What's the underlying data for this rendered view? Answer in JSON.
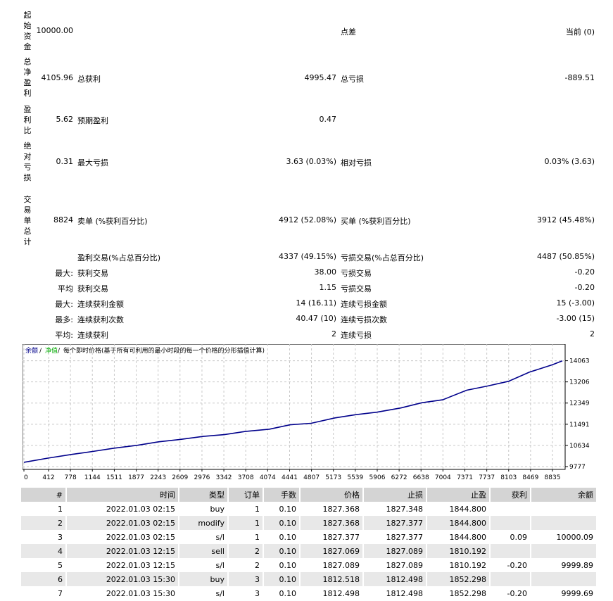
{
  "summary": {
    "initial_deposit": {
      "label": "起始资金",
      "value": "10000.00"
    },
    "spread": {
      "label": "点差",
      "value": "当前 (0)"
    },
    "net_profit": {
      "label": "总净盈利",
      "value": "4105.96"
    },
    "gross_profit": {
      "label": "总获利",
      "value": "4995.47"
    },
    "gross_loss": {
      "label": "总亏损",
      "value": "-889.51"
    },
    "profit_factor": {
      "label": "盈利比",
      "value": "5.62"
    },
    "expected_payoff": {
      "label": "预期盈利",
      "value": "0.47"
    },
    "abs_drawdown": {
      "label": "绝对亏损",
      "value": "0.31"
    },
    "max_drawdown": {
      "label": "最大亏损",
      "value": "3.63 (0.03%)"
    },
    "rel_drawdown": {
      "label": "相对亏损",
      "value": "0.03% (3.63)"
    },
    "total_trades": {
      "label": "交易单总计",
      "value": "8824"
    },
    "short_positions": {
      "label": "卖单 (%获利百分比)",
      "value": "4912 (52.08%)"
    },
    "long_positions": {
      "label": "买单 (%获利百分比)",
      "value": "3912 (45.48%)"
    },
    "profit_trades": {
      "label": "盈利交易(%占总百分比)",
      "value": "4337 (49.15%)"
    },
    "loss_trades": {
      "label": "亏损交易(%占总百分比)",
      "value": "4487 (50.85%)"
    },
    "largest": {
      "prefix": "最大:",
      "profit_label": "获利交易",
      "profit_value": "38.00",
      "loss_label": "亏损交易",
      "loss_value": "-0.20"
    },
    "average": {
      "prefix": "平均",
      "profit_label": "获利交易",
      "profit_value": "1.15",
      "loss_label": "亏损交易",
      "loss_value": "-0.20"
    },
    "max_consec_amount": {
      "prefix": "最大:",
      "profit_label": "连续获利金额",
      "profit_value": "14 (16.11)",
      "loss_label": "连续亏损金额",
      "loss_value": "15 (-3.00)"
    },
    "max_consec_count": {
      "prefix": "最多:",
      "profit_label": "连续获利次数",
      "profit_value": "40.47 (10)",
      "loss_label": "连续亏损次数",
      "loss_value": "-3.00 (15)"
    },
    "avg_consec": {
      "prefix": "平均:",
      "profit_label": "连续获利",
      "profit_value": "2",
      "loss_label": "连续亏损",
      "loss_value": "2"
    }
  },
  "chart_data": {
    "type": "line",
    "legend": {
      "balance": "余额",
      "sep1": " / ",
      "equity": "净值",
      "sep2": " / ",
      "model": "每个即时价格(基于所有可利用的最小时段的每一个价格的分形插值计算)"
    },
    "colors": {
      "balance": "#00008b",
      "equity": "#00aa00",
      "grid": "#c8c8c8"
    },
    "x_ticks": [
      "0",
      "412",
      "778",
      "1144",
      "1511",
      "1877",
      "2243",
      "2609",
      "2976",
      "3342",
      "3708",
      "4074",
      "4441",
      "4807",
      "5173",
      "5539",
      "5906",
      "6272",
      "6638",
      "7004",
      "7371",
      "7737",
      "8103",
      "8469",
      "8835"
    ],
    "y_ticks": [
      "14063",
      "13206",
      "12349",
      "11491",
      "10634",
      "9777"
    ],
    "xlim": [
      0,
      9000
    ],
    "ylim": [
      9777,
      14450
    ],
    "series": [
      {
        "name": "余额",
        "x": [
          0,
          400,
          800,
          1150,
          1500,
          1900,
          2250,
          2600,
          3000,
          3350,
          3700,
          4100,
          4450,
          4800,
          5200,
          5550,
          5900,
          6300,
          6650,
          7000,
          7400,
          7750,
          8100,
          8450,
          8835,
          9000
        ],
        "y": [
          9950,
          10120,
          10270,
          10390,
          10520,
          10640,
          10780,
          10870,
          11000,
          11070,
          11200,
          11290,
          11470,
          11530,
          11750,
          11880,
          11980,
          12150,
          12360,
          12480,
          12870,
          13040,
          13230,
          13600,
          13900,
          14060
        ]
      }
    ]
  },
  "table": {
    "headers": [
      "#",
      "时间",
      "类型",
      "订单",
      "手数",
      "价格",
      "止损",
      "止盈",
      "获利",
      "余额"
    ],
    "rows": [
      [
        "1",
        "2022.01.03 02:15",
        "buy",
        "1",
        "0.10",
        "1827.368",
        "1827.348",
        "1844.800",
        "",
        ""
      ],
      [
        "2",
        "2022.01.03 02:15",
        "modify",
        "1",
        "0.10",
        "1827.368",
        "1827.377",
        "1844.800",
        "",
        ""
      ],
      [
        "3",
        "2022.01.03 02:15",
        "s/l",
        "1",
        "0.10",
        "1827.377",
        "1827.377",
        "1844.800",
        "0.09",
        "10000.09"
      ],
      [
        "4",
        "2022.01.03 12:15",
        "sell",
        "2",
        "0.10",
        "1827.069",
        "1827.089",
        "1810.192",
        "",
        ""
      ],
      [
        "5",
        "2022.01.03 12:15",
        "s/l",
        "2",
        "0.10",
        "1827.089",
        "1827.089",
        "1810.192",
        "-0.20",
        "9999.89"
      ],
      [
        "6",
        "2022.01.03 15:30",
        "buy",
        "3",
        "0.10",
        "1812.518",
        "1812.498",
        "1852.298",
        "",
        ""
      ],
      [
        "7",
        "2022.01.03 15:30",
        "s/l",
        "3",
        "0.10",
        "1812.498",
        "1812.498",
        "1852.298",
        "-0.20",
        "9999.69"
      ]
    ]
  }
}
